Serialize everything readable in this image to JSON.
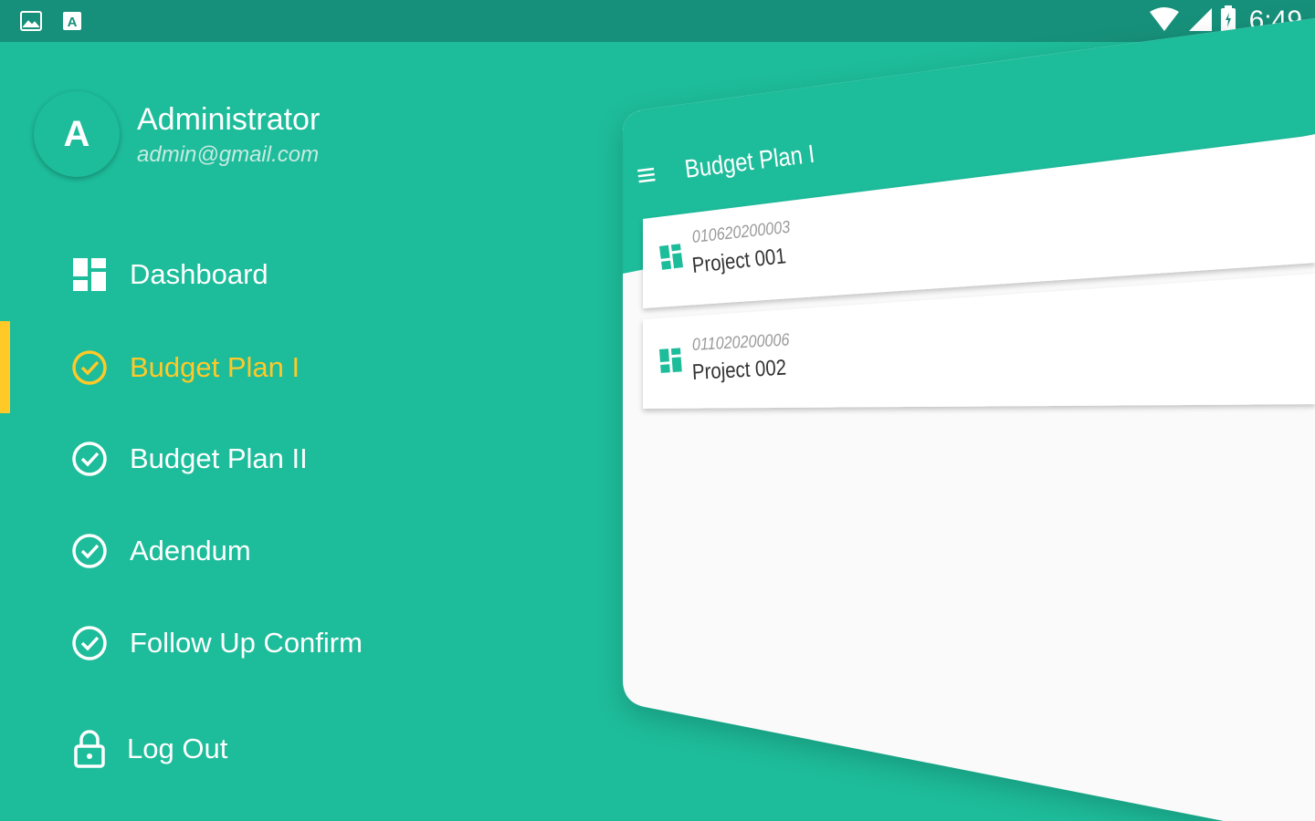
{
  "status_bar": {
    "time": "6:49",
    "left_icons": [
      "image-icon",
      "text-a-icon"
    ],
    "right_icons": [
      "wifi-icon",
      "signal-icon",
      "battery-icon"
    ]
  },
  "profile": {
    "avatar_letter": "A",
    "name": "Administrator",
    "email": "admin@gmail.com"
  },
  "menu": {
    "items": [
      {
        "label": "Dashboard",
        "icon": "dashboard-icon",
        "active": false
      },
      {
        "label": "Budget Plan I",
        "icon": "check-circle-icon",
        "active": true
      },
      {
        "label": "Budget Plan II",
        "icon": "check-circle-icon",
        "active": false
      },
      {
        "label": "Adendum",
        "icon": "check-circle-icon",
        "active": false
      },
      {
        "label": "Follow Up Confirm",
        "icon": "check-circle-icon",
        "active": false
      }
    ],
    "logout_label": "Log Out"
  },
  "preview": {
    "title": "Budget Plan I",
    "rows": [
      {
        "code": "010620200003",
        "name": "Project 001"
      },
      {
        "code": "011020200006",
        "name": "Project 002"
      }
    ]
  },
  "colors": {
    "accent": "#1dbc9a",
    "status_bar": "#16907a",
    "active": "#ffc928"
  }
}
